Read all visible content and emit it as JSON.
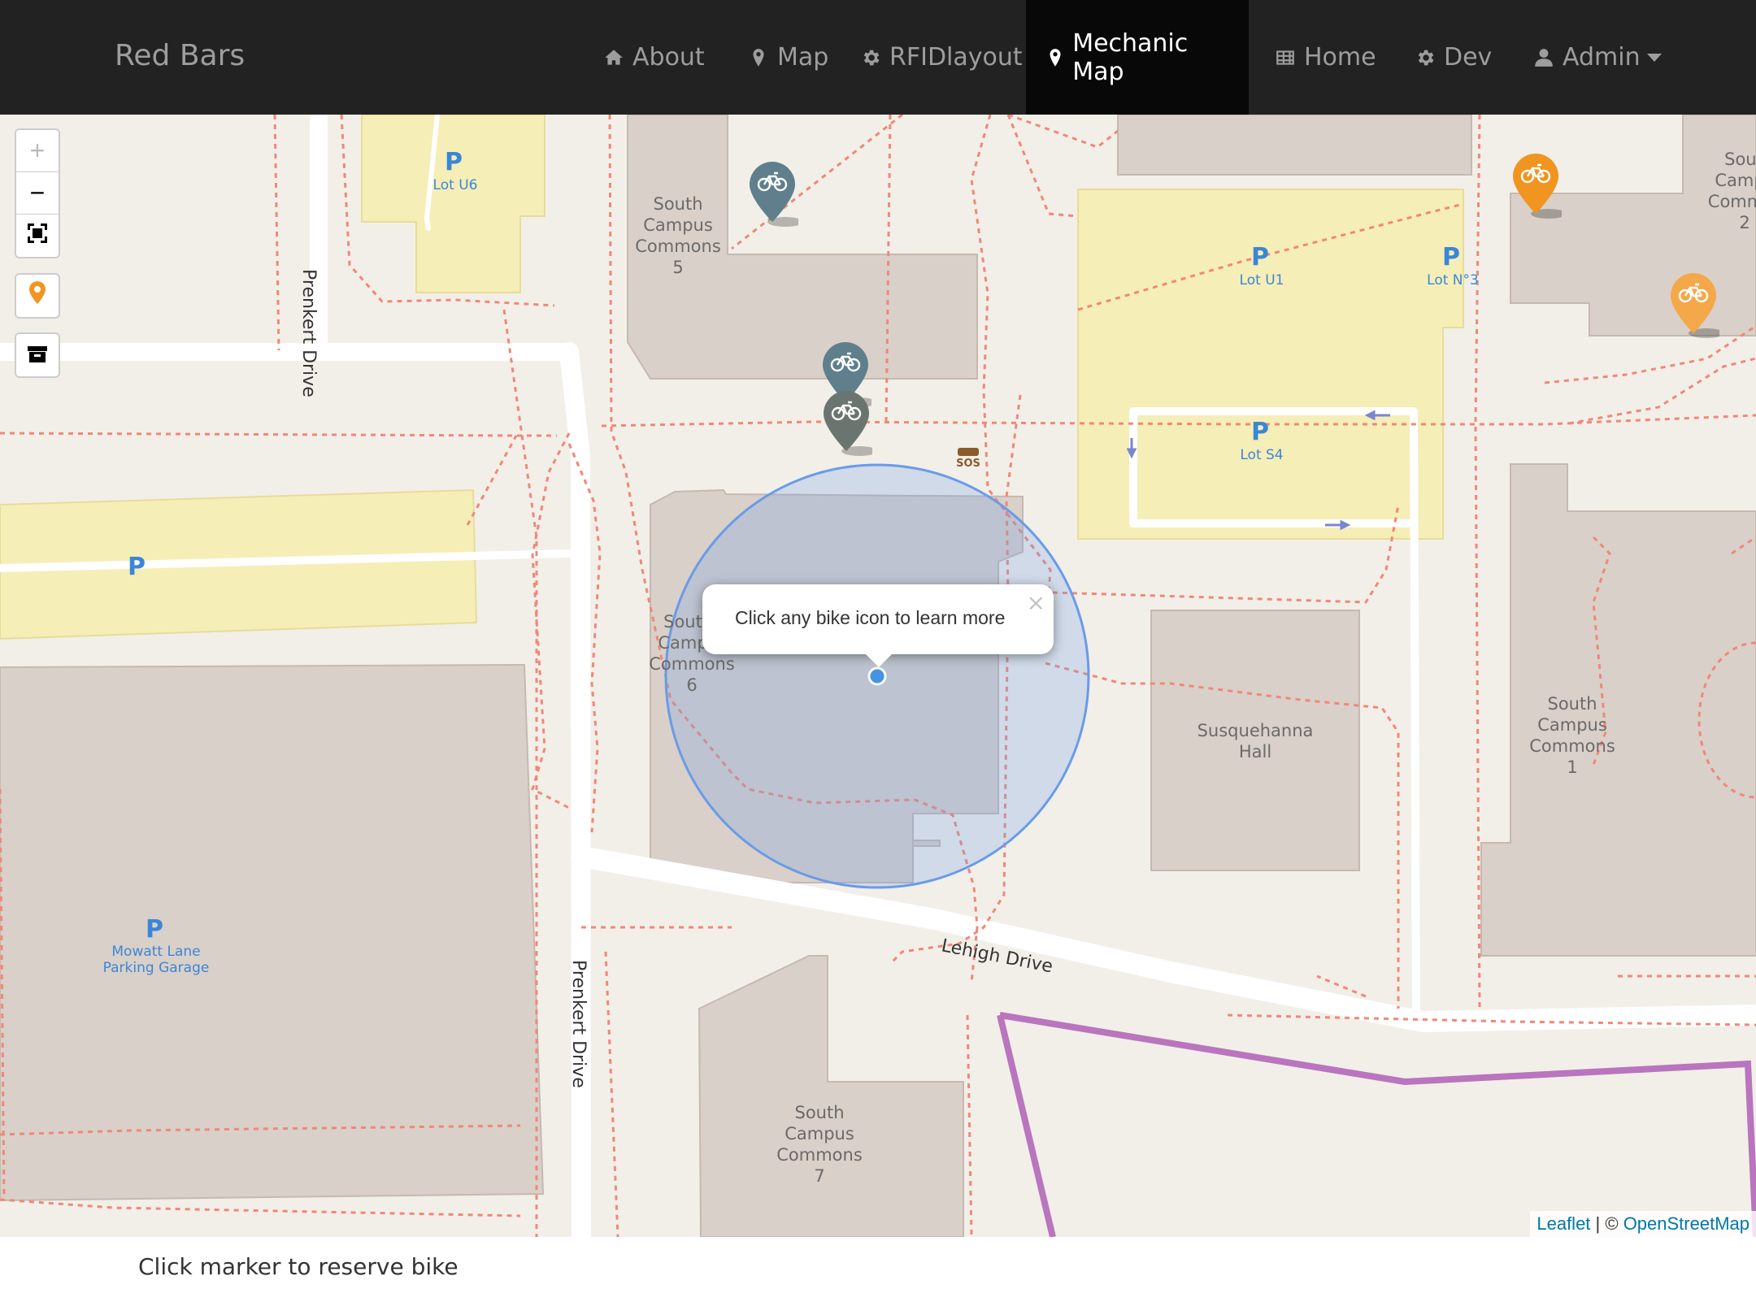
{
  "navbar": {
    "brand": "Red Bars",
    "items": [
      {
        "label": "About",
        "icon": "home-icon"
      },
      {
        "label": "Map",
        "icon": "map-marker-icon"
      },
      {
        "label": "RFIDlayout",
        "icon": "gear-icon"
      },
      {
        "label": "Mechanic Map",
        "icon": "map-marker-icon",
        "active": true
      },
      {
        "label": "Home",
        "icon": "table-icon"
      },
      {
        "label": "Dev",
        "icon": "gear-icon"
      },
      {
        "label": "Admin",
        "icon": "user-icon",
        "dropdown": true
      }
    ]
  },
  "map": {
    "controls": {
      "zoom_in": "+",
      "zoom_out": "−"
    },
    "labels": {
      "road_prenkert_1": "Prenkert Drive",
      "road_prenkert_2": "Prenkert Drive",
      "road_lehigh": "Lehigh Drive",
      "lot_u6": "Lot U6",
      "lot_u1": "Lot U1",
      "lot_n3": "Lot N°3",
      "lot_s4": "Lot S4",
      "garage_1": "Mowatt Lane",
      "garage_2": "Parking Garage",
      "parking_symbol": "P",
      "scc5": [
        "South",
        "Campus",
        "Commons",
        "5"
      ],
      "scc6": [
        "Sout",
        "Camp",
        "Commons",
        "6"
      ],
      "scc7": [
        "South",
        "Campus",
        "Commons",
        "7"
      ],
      "scc1": [
        "South",
        "Campus",
        "Commons",
        "1"
      ],
      "scc2": [
        "Sout",
        "Camp",
        "Comm",
        "2"
      ],
      "susquehanna": [
        "Susquehanna",
        "Hall"
      ],
      "sos": "SOS"
    },
    "popup": {
      "text": "Click any bike icon to learn more",
      "close": "×"
    },
    "attribution": {
      "leaflet": "Leaflet",
      "separator": " | © ",
      "osm": "OpenStreetMap"
    },
    "colors": {
      "marker_blue_gray": "#5f7f8c",
      "marker_gray": "#6b7570",
      "marker_orange": "#f0951f",
      "accuracy_circle": "#6a9be8",
      "boundary": "#b975bd"
    }
  },
  "footer": {
    "text": "Click marker to reserve bike"
  }
}
